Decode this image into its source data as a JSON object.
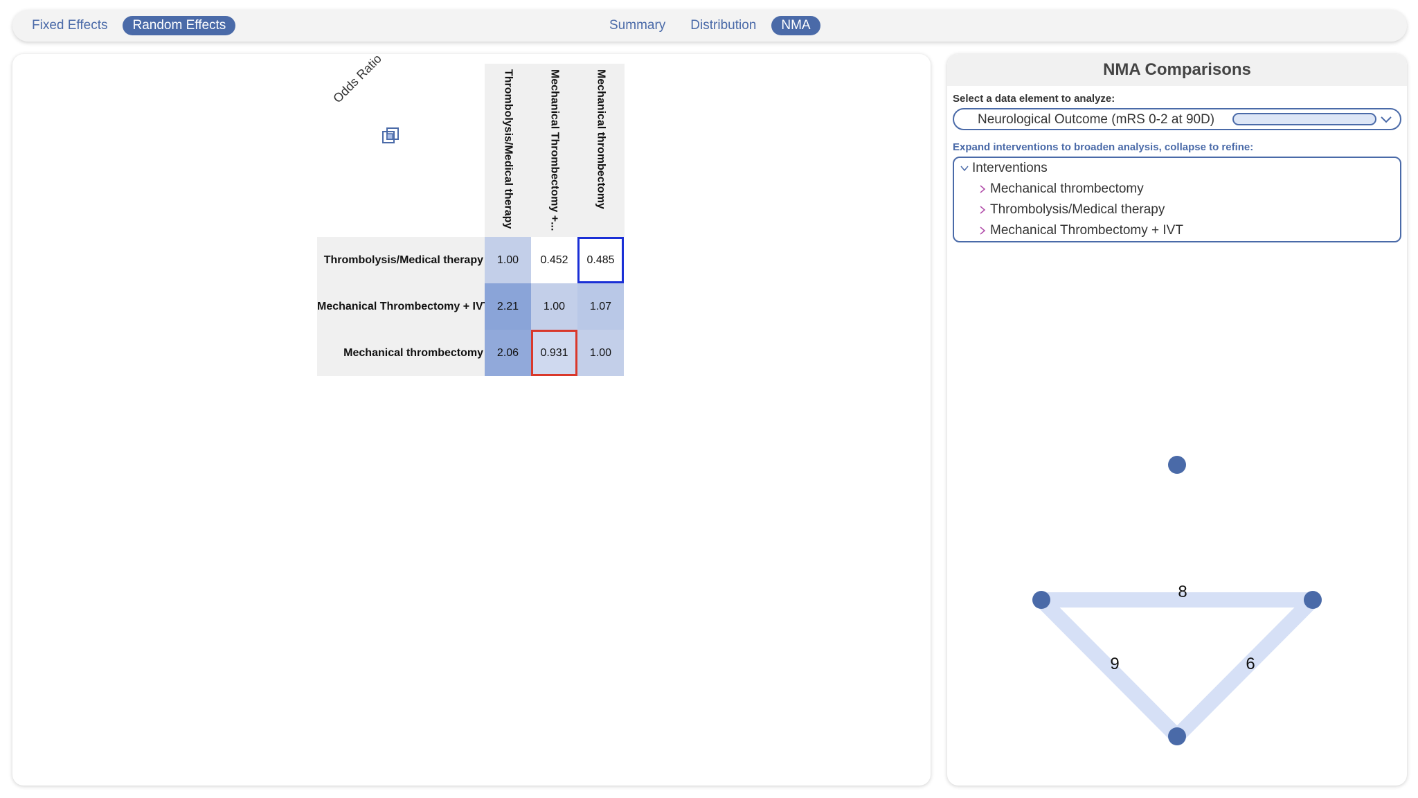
{
  "topbar": {
    "effects_tabs": [
      {
        "label": "Fixed Effects",
        "active": false
      },
      {
        "label": "Random Effects",
        "active": true
      }
    ],
    "view_tabs": [
      {
        "label": "Summary",
        "active": false
      },
      {
        "label": "Distribution",
        "active": false
      },
      {
        "label": "NMA",
        "active": true
      }
    ]
  },
  "matrix": {
    "metric_label": "Odds Ratio",
    "icon": "copy-squares-icon",
    "columns": [
      "Thrombolysis/Medical therapy",
      "Mechanical Thrombectomy +...",
      "Mechanical thrombectomy"
    ],
    "rows": [
      {
        "label": "Thrombolysis/Medical therapy",
        "values": [
          "1.00",
          "0.452",
          "0.485"
        ]
      },
      {
        "label": "Mechanical Thrombectomy + IVT",
        "values": [
          "2.21",
          "1.00",
          "1.07"
        ]
      },
      {
        "label": "Mechanical thrombectomy",
        "values": [
          "2.06",
          "0.931",
          "1.00"
        ]
      }
    ],
    "highlight_blue": [
      0,
      2
    ],
    "highlight_red": [
      2,
      1
    ]
  },
  "right_panel": {
    "title": "NMA Comparisons",
    "select_label": "Select a data element to analyze:",
    "select_value": "Neurological Outcome (mRS 0-2 at 90D)",
    "expand_label": "Expand interventions to broaden analysis, collapse to refine:",
    "tree_root": "Interventions",
    "tree_items": [
      "Mechanical thrombectomy",
      "Thrombolysis/Medical therapy",
      "Mechanical Thrombectomy + IVT"
    ]
  },
  "network": {
    "edge_labels": [
      "8",
      "9",
      "6"
    ],
    "node_color": "#4a6aa8",
    "edge_color": "#d6e0f6"
  },
  "colors": {
    "accent": "#4a6aa8",
    "highlight_blue": "#1a2fd6",
    "highlight_red": "#d9382b"
  }
}
